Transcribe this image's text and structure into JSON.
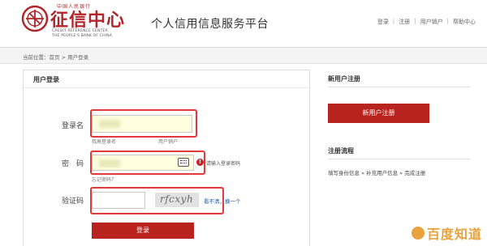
{
  "header": {
    "logo": {
      "top_text": "中国人民银行",
      "main_text": "征信中心",
      "en_line1": "CREDIT REFERENCE CENTER",
      "en_line2": "THE PEOPLE'S BANK OF CHINA"
    },
    "platform_title": "个人信用信息服务平台",
    "links": [
      "登录",
      "注册",
      "用户销户",
      "帮助中心"
    ],
    "link_separator": "|"
  },
  "breadcrumb": "当前位置：首页 > 用户登录",
  "login": {
    "title": "用户登录",
    "username_label": "登录名",
    "username_hint_left": "我高登录名",
    "username_hint_right": "用户销户",
    "password_label": "密　码",
    "password_warning": "请输入登录密码",
    "forgot_text": "忘记密码？",
    "captcha_label": "验证码",
    "captcha_value": "rfcxyh",
    "captcha_refresh": "看不清，换一个",
    "submit_label": "登录"
  },
  "register": {
    "title": "新用户注册",
    "button_label": "新用户注册"
  },
  "flow": {
    "title": "注册流程",
    "steps": "填写身份信息 » 补充用户信息 » 完成注册"
  },
  "watermark": {
    "text": "百度知道"
  },
  "colors": {
    "brand_red": "#b8231f",
    "highlight_red": "#e23a3a",
    "autofill_yellow": "#ffffe0"
  }
}
